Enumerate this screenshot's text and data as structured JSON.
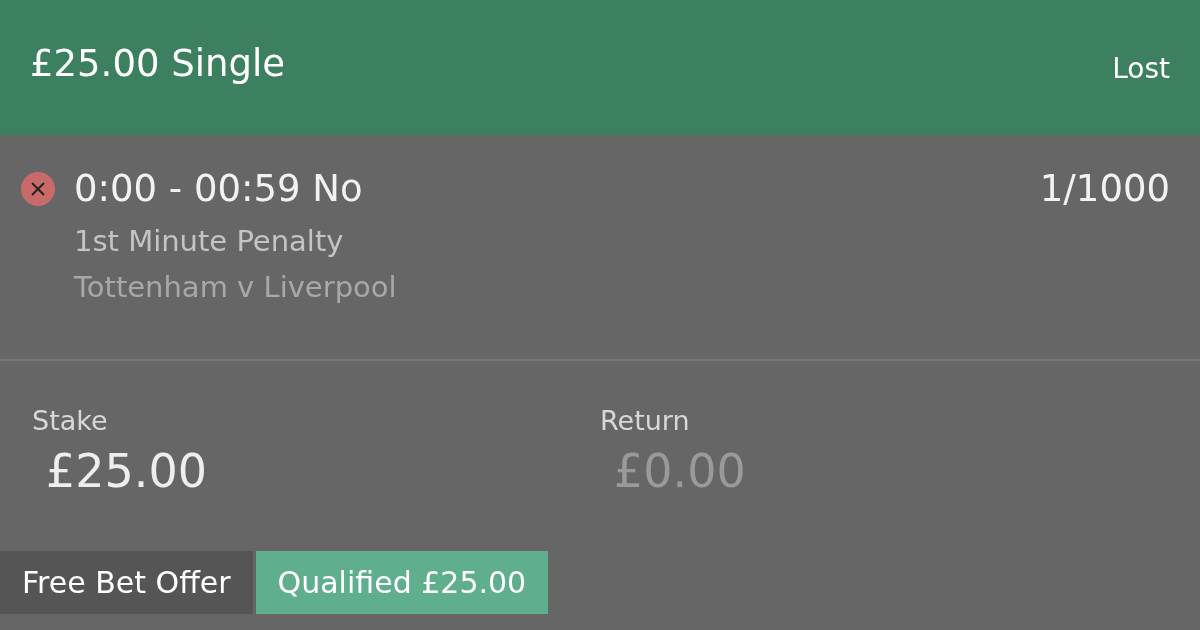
{
  "header": {
    "title": "£25.00 Single",
    "status": "Lost"
  },
  "selection": {
    "lost": true,
    "name": "0:00 - 00:59 No",
    "odds": "1/1000",
    "market": "1st Minute Penalty",
    "event": "Tottenham v Liverpool"
  },
  "amounts": [
    {
      "label": "Stake",
      "value": "£25.00",
      "muted": false
    },
    {
      "label": "Return",
      "value": "£0.00",
      "muted": true
    }
  ],
  "offer": {
    "label": "Free Bet Offer",
    "value": "Qualified £25.00"
  }
}
